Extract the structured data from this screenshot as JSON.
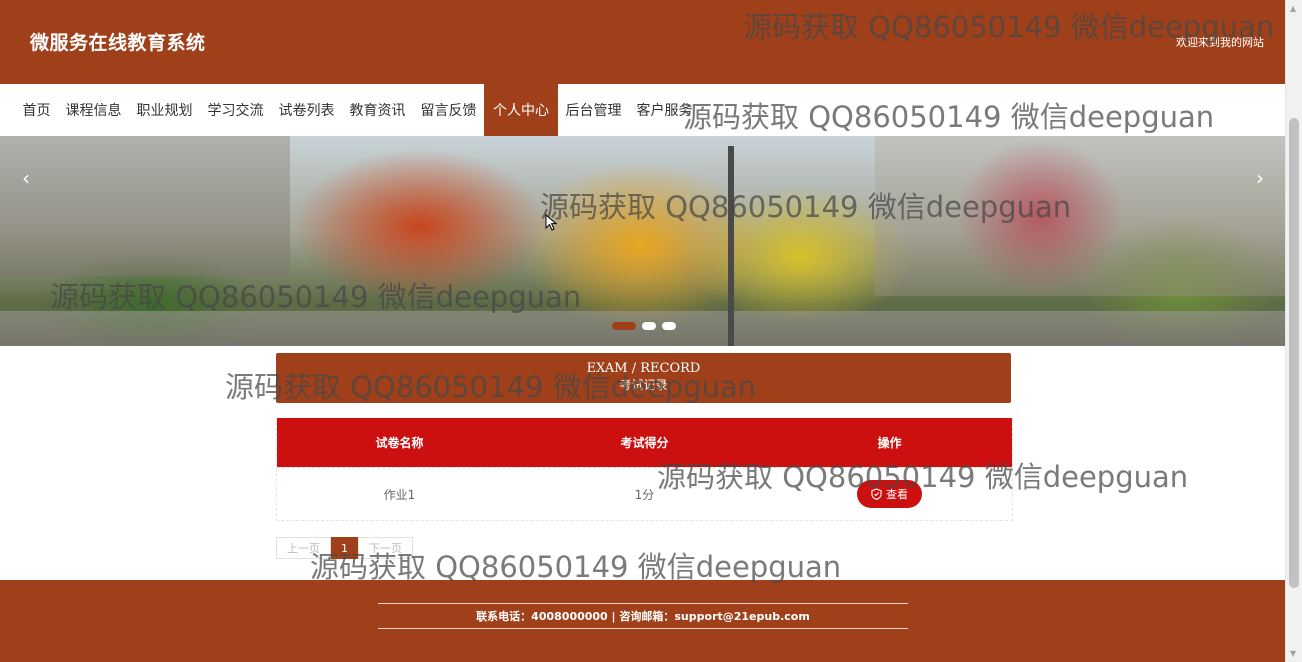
{
  "header": {
    "site_title": "微服务在线教育系统",
    "welcome": "欢迎来到我的网站"
  },
  "nav": {
    "items": [
      {
        "label": "首页"
      },
      {
        "label": "课程信息"
      },
      {
        "label": "职业规划"
      },
      {
        "label": "学习交流"
      },
      {
        "label": "试卷列表"
      },
      {
        "label": "教育资讯"
      },
      {
        "label": "留言反馈"
      },
      {
        "label": "个人中心",
        "active": true
      },
      {
        "label": "后台管理"
      },
      {
        "label": "客户服务"
      }
    ]
  },
  "banner": {
    "prev_icon": "chevron-left-icon",
    "next_icon": "chevron-right-icon",
    "slide_count": 3,
    "active_slide": 1
  },
  "section": {
    "title_en": "EXAM / RECORD",
    "title_cn": "考试记录"
  },
  "table": {
    "headers": [
      "试卷名称",
      "考试得分",
      "操作"
    ],
    "rows": [
      {
        "name": "作业1",
        "score": "1分",
        "action": "查看"
      }
    ]
  },
  "pager": {
    "prev": "上一页",
    "current": "1",
    "next": "下一页"
  },
  "footer": {
    "contact": "联系电话：4008000000 | 咨询邮箱：support@21epub.com"
  },
  "watermarks": [
    "源码获取 QQ86050149 微信deepguan",
    "源码获取 QQ86050149 微信deepguan",
    "源码获取 QQ86050149 微信deepguan",
    "源码获取 QQ86050149 微信deepguan",
    "源码获取 QQ86050149 微信deepguan",
    "源码获取 QQ86050149 微信deepguan",
    "源码获取 QQ86050149 微信deepguan"
  ],
  "colors": {
    "brand": "#a0401a",
    "table_header": "#cc1010",
    "button": "#cc1010"
  }
}
